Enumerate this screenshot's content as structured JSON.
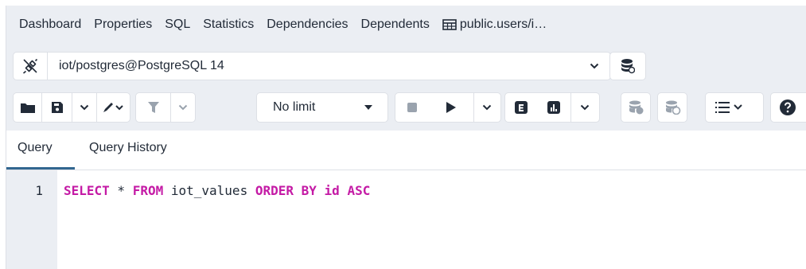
{
  "colors": {
    "accent": "#326690",
    "keyword": "#c41aa5",
    "toolbar_bg": "#ebeef3"
  },
  "tabs": [
    {
      "label": "Dashboard"
    },
    {
      "label": "Properties"
    },
    {
      "label": "SQL"
    },
    {
      "label": "Statistics"
    },
    {
      "label": "Dependencies"
    },
    {
      "label": "Dependents"
    },
    {
      "label": "public.users/i…",
      "icon": "table-icon"
    }
  ],
  "connection": {
    "label": "iot/postgres@PostgreSQL 14",
    "icon": "disconnect-icon"
  },
  "toolbar": {
    "limit_label": "No limit",
    "icons": [
      "open-file-icon",
      "save-icon",
      "save-dropdown-icon",
      "edit-icon",
      "filter-icon",
      "filter-dropdown-icon",
      "stop-icon",
      "execute-icon",
      "execute-dropdown-icon",
      "explain-icon",
      "explain-analyze-icon",
      "explain-dropdown-icon",
      "commit-icon",
      "rollback-icon",
      "macros-icon",
      "help-icon"
    ]
  },
  "query_tabs": [
    {
      "label": "Query"
    },
    {
      "label": "Query History"
    }
  ],
  "editor": {
    "line_number": "1",
    "tokens": [
      {
        "text": "SELECT",
        "type": "keyword"
      },
      {
        "text": " * ",
        "type": "plain"
      },
      {
        "text": "FROM",
        "type": "keyword"
      },
      {
        "text": " iot_values ",
        "type": "plain"
      },
      {
        "text": "ORDER BY",
        "type": "keyword"
      },
      {
        "text": " ",
        "type": "plain"
      },
      {
        "text": "id",
        "type": "keyword"
      },
      {
        "text": " ",
        "type": "plain"
      },
      {
        "text": "ASC",
        "type": "keyword"
      }
    ]
  }
}
